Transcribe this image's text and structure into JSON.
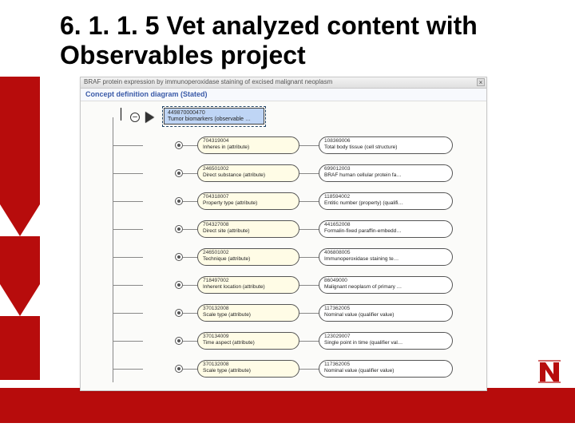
{
  "slide": {
    "title": "6. 1. 1. 5 Vet analyzed content with Observables project"
  },
  "panel": {
    "window_title": "BRAF protein expression by immunoperoxidase staining of excised malignant neoplasm",
    "close_glyph": "×",
    "subtitle": "Concept definition diagram (Stated)"
  },
  "root": {
    "code": "449870000470",
    "label": "Tumor biomarkers (observable …"
  },
  "rows": [
    {
      "attr_code": "704319004",
      "attr_label": "Inheres in (attribute)",
      "val_code": "108369006",
      "val_label": "Total body tissue (cell structure)"
    },
    {
      "attr_code": "246501002",
      "attr_label": "Direct substance (attribute)",
      "val_code": "699012003",
      "val_label": "BRAF human cellular protein fa…"
    },
    {
      "attr_code": "704318007",
      "attr_label": "Property type (attribute)",
      "val_code": "118594002",
      "val_label": "Entitic number (property) (qualifi…"
    },
    {
      "attr_code": "704327008",
      "attr_label": "Direct site (attribute)",
      "val_code": "441652008",
      "val_label": "Formalin-fixed paraffin-embedd…"
    },
    {
      "attr_code": "246501002",
      "attr_label": "Technique (attribute)",
      "val_code": "406808005",
      "val_label": "Immunoperoxidase staining te…"
    },
    {
      "attr_code": "718497002",
      "attr_label": "Inherent location (attribute)",
      "val_code": "86049000",
      "val_label": "Malignant neoplasm of primary …"
    },
    {
      "attr_code": "370132008",
      "attr_label": "Scale type (attribute)",
      "val_code": "117362005",
      "val_label": "Nominal value (qualifier value)"
    },
    {
      "attr_code": "370134009",
      "attr_label": "Time aspect (attribute)",
      "val_code": "123029007",
      "val_label": "Single point in time (qualifier val…"
    },
    {
      "attr_code": "370132008",
      "attr_label": "Scale type (attribute)",
      "val_code": "117362005",
      "val_label": "Nominal value (qualifier value)"
    }
  ],
  "icons": {
    "minus": "–"
  }
}
